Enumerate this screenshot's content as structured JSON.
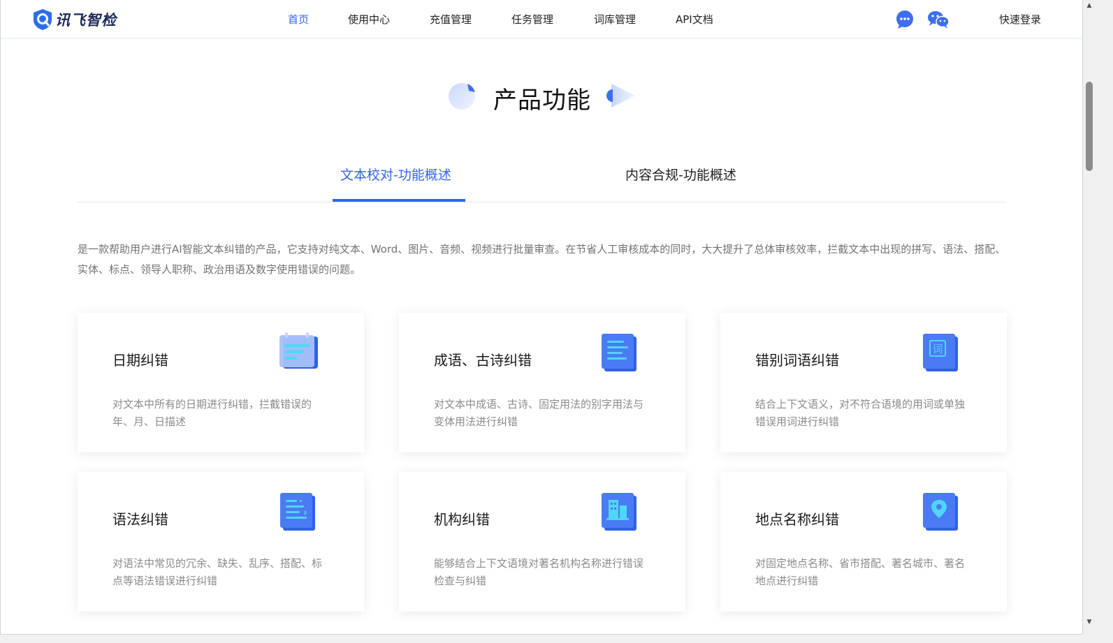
{
  "header": {
    "logo_text": "讯飞智检",
    "nav": [
      {
        "label": "首页",
        "active": true
      },
      {
        "label": "使用中心",
        "active": false
      },
      {
        "label": "充值管理",
        "active": false
      },
      {
        "label": "任务管理",
        "active": false
      },
      {
        "label": "词库管理",
        "active": false
      },
      {
        "label": "API文档",
        "active": false
      }
    ],
    "icons": [
      "chat-bubble-icon",
      "wechat-icon"
    ],
    "login_label": "快速登录"
  },
  "section": {
    "title": "产品功能"
  },
  "tabs": [
    {
      "label": "文本校对-功能概述",
      "active": true
    },
    {
      "label": "内容合规-功能概述",
      "active": false
    }
  ],
  "description": "是一款帮助用户进行AI智能文本纠错的产品，它支持对纯文本、Word、图片、音频、视频进行批量审查。在节省人工审核成本的同时，大大提升了总体审核效率，拦截文本中出现的拼写、语法、搭配、实体、标点、领导人职称、政治用语及数字使用错误的问题。",
  "cards": [
    {
      "title": "日期纠错",
      "desc": "对文本中所有的日期进行纠错，拦截错误的年、月、日描述",
      "icon": "calendar-icon"
    },
    {
      "title": "成语、古诗纠错",
      "desc": "对文本中成语、古诗、固定用法的别字用法与变体用法进行纠错",
      "icon": "document-icon"
    },
    {
      "title": "错别词语纠错",
      "desc": "结合上下文语义，对不符合语境的用词或单独错误用词进行纠错",
      "icon": "word-icon",
      "icon_text": "词"
    },
    {
      "title": "语法纠错",
      "desc": "对语法中常见的冗余、缺失、乱序、搭配、标点等语法错误进行纠错",
      "icon": "grammar-icon"
    },
    {
      "title": "机构纠错",
      "desc": "能够结合上下文语境对著名机构名称进行错误检查与纠错",
      "icon": "building-icon"
    },
    {
      "title": "地点名称纠错",
      "desc": "对固定地点名称、省市搭配、著名城市、著名地点进行纠错",
      "icon": "location-pin-icon"
    }
  ],
  "colors": {
    "accent": "#3265f0",
    "icon_blue": "#3b6ef2",
    "icon_cyan": "#4fd7f5"
  }
}
